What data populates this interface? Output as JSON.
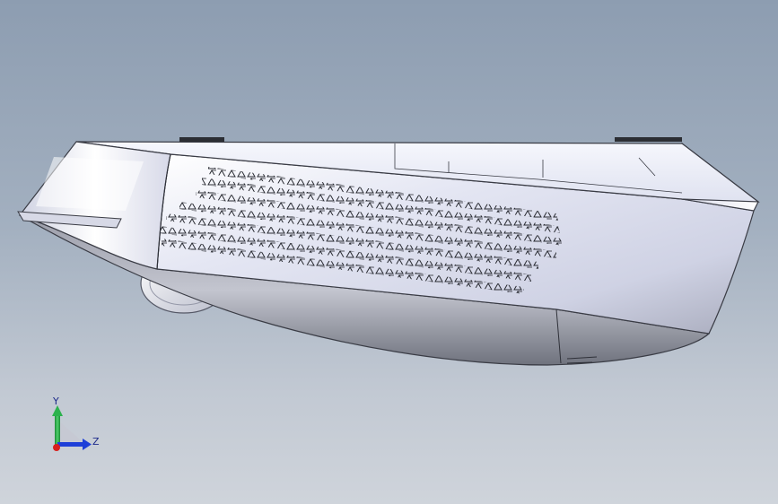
{
  "viewport": {
    "background_top": "#8d9db1",
    "background_bottom": "#cfd4db"
  },
  "model": {
    "icon": "cad-part-3d-model",
    "body_color": "#e8eaf6",
    "shadow_color": "#6f7380",
    "vent_rows": 7
  },
  "triad": {
    "y_label": "Y",
    "z_label": "Z",
    "y_color": "#2bb24c",
    "z_color": "#1e3fd8",
    "x_color": "#d8201e"
  }
}
